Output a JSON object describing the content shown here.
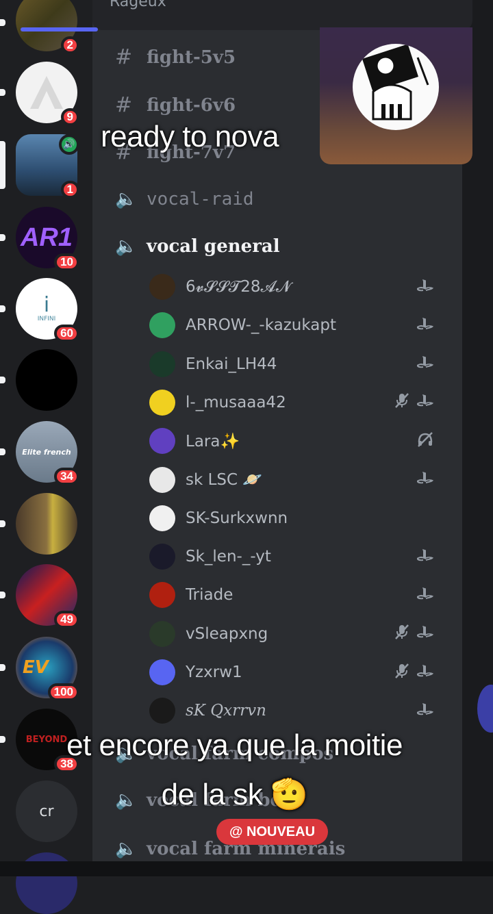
{
  "server_list": {
    "badges": [
      "2",
      "9",
      "1",
      "10",
      "60",
      "34",
      "49",
      "100",
      "38"
    ],
    "server_labels": [
      "AR1",
      "INFINI",
      "Elite french",
      "EV",
      "BEYOND"
    ],
    "home_initials": "cr"
  },
  "header": {
    "server_name": "Rageux"
  },
  "channels": {
    "text": [
      "fight-5v5",
      "fight-6v6",
      "fight-7v7"
    ],
    "voice": [
      "vocal-raid",
      "vocal general",
      "vocal farm compos",
      "vocal farm bois",
      "vocal farm minerais"
    ]
  },
  "voice_members": [
    {
      "name": "6𝓿𝓢𝓢𝓣28𝓐𝓝",
      "icons": [
        "playstation-icon"
      ]
    },
    {
      "name": "ARROW-_-kazukapt",
      "icons": [
        "playstation-icon"
      ]
    },
    {
      "name": "Enkai_LH44",
      "icons": [
        "playstation-icon"
      ]
    },
    {
      "name": "l-_musaaa42",
      "icons": [
        "muted-mic-icon",
        "playstation-icon"
      ]
    },
    {
      "name": "Lara✨",
      "icons": [
        "deafened-icon"
      ]
    },
    {
      "name": "sk  LSC 🪐",
      "icons": [
        "playstation-icon"
      ]
    },
    {
      "name": "SK-Surkxwnn",
      "icons": []
    },
    {
      "name": "Sk_len-_-yt",
      "icons": [
        "playstation-icon"
      ]
    },
    {
      "name": "Triade",
      "icons": [
        "playstation-icon"
      ]
    },
    {
      "name": "vSleapxng",
      "icons": [
        "muted-mic-icon",
        "playstation-icon"
      ]
    },
    {
      "name": "Yzxrw1",
      "icons": [
        "muted-mic-icon",
        "playstation-icon"
      ]
    },
    {
      "name": "sK Qxrrvn",
      "icons": [
        "playstation-icon"
      ]
    }
  ],
  "captions": {
    "top": "ready to nova",
    "bottom_line1": "et encore ya que la moitie",
    "bottom_line2": "de la sk 🫡"
  },
  "new_button": {
    "label": "@ NOUVEAU"
  },
  "colors": {
    "accent": "#5865f2",
    "badge": "#f23f42",
    "voice_green": "#23a559"
  }
}
